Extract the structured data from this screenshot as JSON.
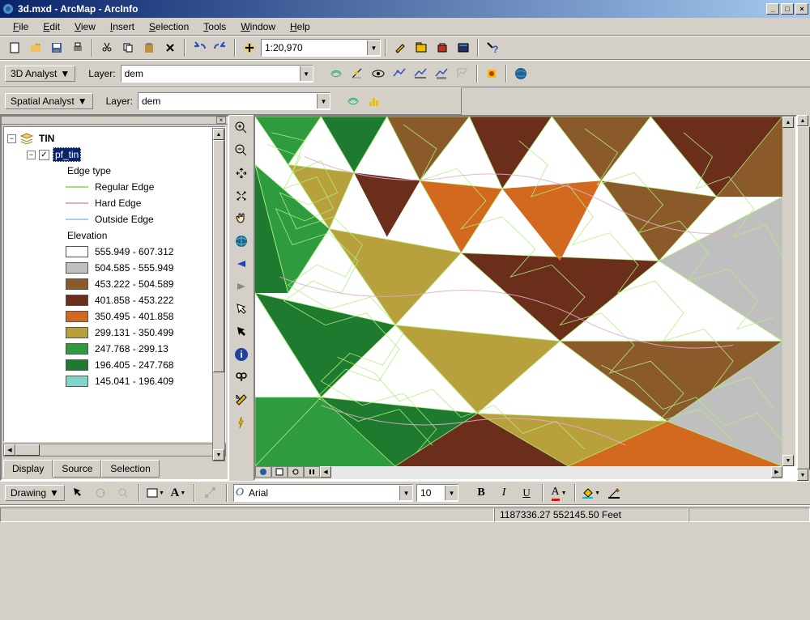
{
  "title": "3d.mxd - ArcMap - ArcInfo",
  "menu": [
    "File",
    "Edit",
    "View",
    "Insert",
    "Selection",
    "Tools",
    "Window",
    "Help"
  ],
  "scale": "1:20,970",
  "analyst3d": {
    "label": "3D Analyst",
    "layer_label": "Layer:",
    "layer_value": "dem"
  },
  "spatial": {
    "label": "Spatial Analyst",
    "layer_label": "Layer:",
    "layer_value": "dem"
  },
  "toc": {
    "root": "TIN",
    "layer": "pf_tin",
    "edge_type_label": "Edge type",
    "edges": [
      {
        "label": "Regular Edge",
        "color": "#9be27a"
      },
      {
        "label": "Hard Edge",
        "color": "#e6a8d0"
      },
      {
        "label": "Outside Edge",
        "color": "#a8d0e6"
      }
    ],
    "elevation_label": "Elevation",
    "classes": [
      {
        "label": "555.949 - 607.312",
        "color": "#ffffff"
      },
      {
        "label": "504.585 - 555.949",
        "color": "#bfbfbf"
      },
      {
        "label": "453.222 - 504.589",
        "color": "#8b5a2b"
      },
      {
        "label": "401.858 - 453.222",
        "color": "#6b2e1a"
      },
      {
        "label": "350.495 - 401.858",
        "color": "#d2691e"
      },
      {
        "label": "299.131 - 350.499",
        "color": "#b8a03c"
      },
      {
        "label": "247.768 - 299.13",
        "color": "#2e9b3e"
      },
      {
        "label": "196.405 - 247.768",
        "color": "#1e7a2e"
      },
      {
        "label": "145.041 - 196.409",
        "color": "#7fd6c8"
      }
    ],
    "tabs": [
      "Display",
      "Source",
      "Selection"
    ]
  },
  "drawing": {
    "label": "Drawing",
    "font": "Arial",
    "size": "10"
  },
  "status": {
    "coords": "1187336.27 552145.50 Feet"
  }
}
